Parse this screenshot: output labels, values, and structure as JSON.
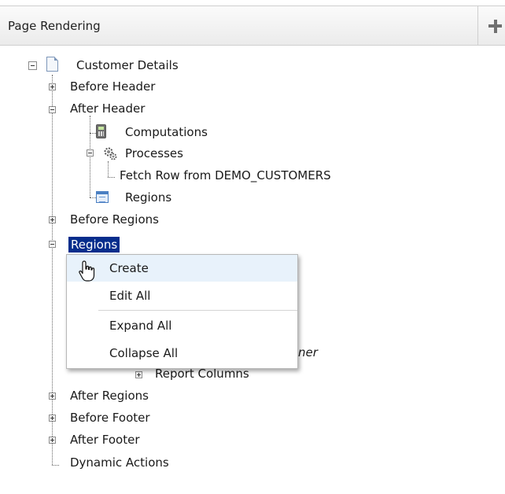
{
  "panel": {
    "title": "Page Rendering",
    "add_icon": "plus-icon"
  },
  "tree": {
    "root": "Customer Details",
    "before_header": "Before Header",
    "after_header": "After Header",
    "computations": "Computations",
    "processes": "Processes",
    "fetch_row": "Fetch Row from DEMO_CUSTOMERS",
    "regions_child": "Regions",
    "before_regions": "Before Regions",
    "regions_selected": "Regions",
    "hidden_partial": "ner",
    "report_columns": "Report Columns",
    "after_regions": "After Regions",
    "before_footer": "Before Footer",
    "after_footer": "After Footer",
    "dynamic_actions": "Dynamic Actions"
  },
  "context_menu": {
    "items": [
      "Create",
      "Edit All",
      "Expand All",
      "Collapse All"
    ]
  },
  "colors": {
    "selection": "#062d8c",
    "menu_hover": "#e8f2fb"
  }
}
